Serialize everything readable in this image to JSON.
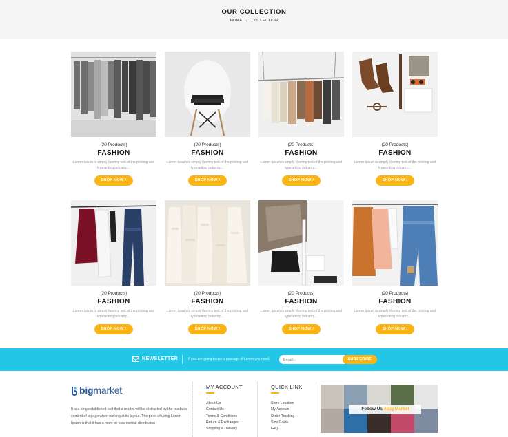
{
  "header": {
    "title": "OUR COLLECTION",
    "breadcrumb": {
      "home": "HOME",
      "separator": "/",
      "current": "COLLECTION"
    }
  },
  "products": [
    {
      "count": "(20 Products)",
      "name": "FASHION",
      "description": "Lorem Ipsum is simply dummy text of the printing and typesetting industry....",
      "button": "SHOP NOW !",
      "image": "hanging-grey-jackets"
    },
    {
      "count": "(20 Products)",
      "name": "FASHION",
      "description": "Lorem Ipsum is simply dummy text of the printing and typesetting industry....",
      "button": "SHOP NOW !",
      "image": "folded-clothes-on-white-chair"
    },
    {
      "count": "(20 Products)",
      "name": "FASHION",
      "description": "Lorem Ipsum is simply dummy text of the printing and typesetting industry....",
      "button": "SHOP NOW !",
      "image": "clothes-rail-with-blouses"
    },
    {
      "count": "(20 Products)",
      "name": "FASHION",
      "description": "Lorem Ipsum is simply dummy text of the printing and typesetting industry....",
      "button": "SHOP NOW !",
      "image": "flat-lay-boots-and-accessories"
    },
    {
      "count": "(20 Products)",
      "name": "FASHION",
      "description": "Lorem Ipsum is simply dummy text of the printing and typesetting industry....",
      "button": "SHOP NOW !",
      "image": "red-coat-and-jeans-on-hangers"
    },
    {
      "count": "(20 Products)",
      "name": "FASHION",
      "description": "Lorem Ipsum is simply dummy text of the printing and typesetting industry....",
      "button": "SHOP NOW !",
      "image": "white-lace-dresses"
    },
    {
      "count": "(20 Products)",
      "name": "FASHION",
      "description": "Lorem Ipsum is simply dummy text of the printing and typesetting industry....",
      "button": "SHOP NOW !",
      "image": "clothes-on-white-stand"
    },
    {
      "count": "(20 Products)",
      "name": "FASHION",
      "description": "Lorem Ipsum is simply dummy text of the printing and typesetting industry....",
      "button": "SHOP NOW !",
      "image": "jackets-and-denim-on-rail"
    }
  ],
  "newsletter": {
    "icon": "envelope-icon",
    "label": "NEWSLETTER",
    "text": "If you are going to use a passage of Lorem you need.",
    "placeholder": "Email...",
    "button": "SUBSCRIBE"
  },
  "footer": {
    "logo": {
      "prefix": "big",
      "suffix": "market"
    },
    "about": "It is a long established fact that a reader will be distracted by the readable content of a page when looking at its layout. The point of using Lorem Ipsum is that it has a more-or-less normal distribution",
    "my_account": {
      "title": "MY ACCOUNT",
      "items": [
        "About Us",
        "Contact Us",
        "Terms & Conditions",
        "Return & Exchanges",
        "Shipping & Delivery"
      ]
    },
    "quick_link": {
      "title": "QUICK LINK",
      "items": [
        "Store Location",
        "My Account",
        "Order Tracking",
        "Size Guide",
        "FAQ"
      ]
    },
    "follow": {
      "text": "Follow Us",
      "tag": "#Big Market"
    }
  },
  "colors": {
    "accent": "#fbb416",
    "newsletter_bg": "#23c6e6",
    "logo_blue": "#2a5a9a"
  }
}
